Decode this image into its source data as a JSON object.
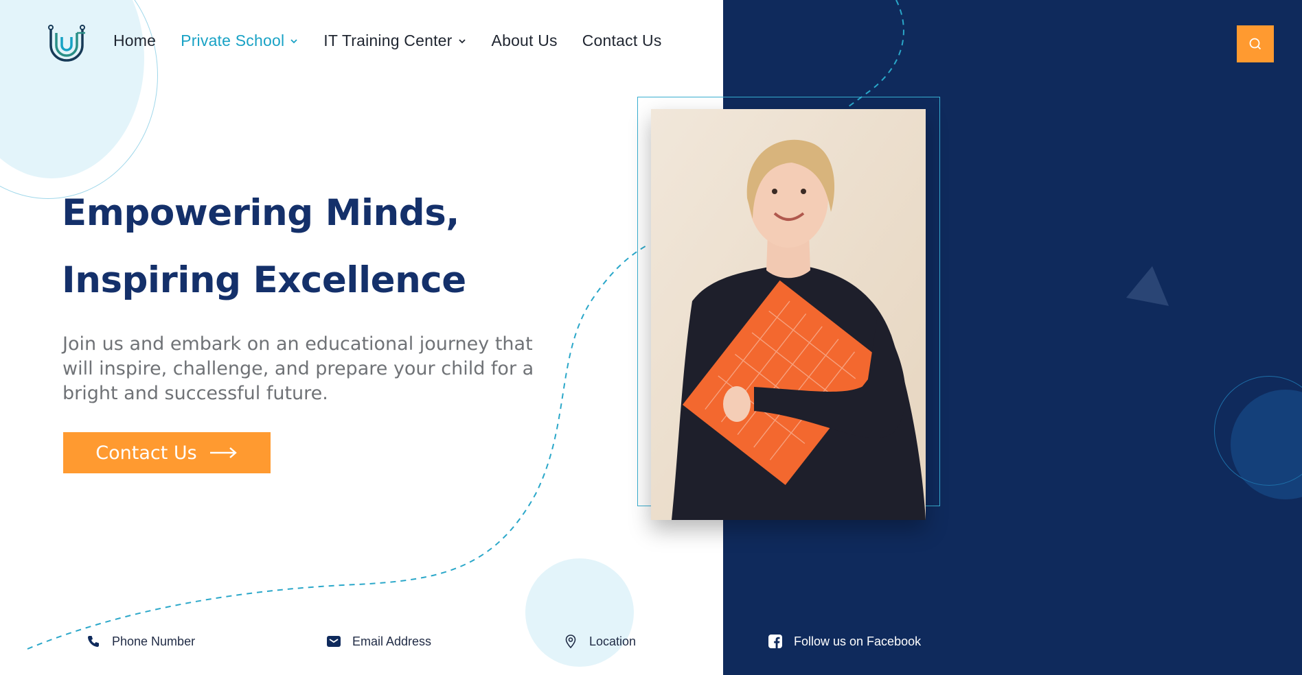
{
  "nav": {
    "items": [
      {
        "label": "Home"
      },
      {
        "label": "Private School"
      },
      {
        "label": "IT Training Center"
      },
      {
        "label": "About Us"
      },
      {
        "label": "Contact Us"
      }
    ]
  },
  "hero": {
    "title_line1": "Empowering Minds,",
    "title_line2": "Inspiring Excellence",
    "subtitle_line1": "Join us and embark on an educational journey that",
    "subtitle_line2": "will inspire, challenge, and prepare your child for a",
    "subtitle_line3": "bright and successful future.",
    "cta_label": "Contact Us"
  },
  "footer": {
    "phone_label": "Phone Number",
    "email_label": "Email Address",
    "location_label": "Location",
    "facebook_label": "Follow us on Facebook"
  },
  "icons": {
    "logo": "logo-icon",
    "search": "search-icon",
    "chevron": "chevron-down-icon",
    "arrow": "arrow-right-icon",
    "phone": "phone-icon",
    "email": "email-icon",
    "location": "location-pin-icon",
    "facebook": "facebook-icon"
  },
  "colors": {
    "navy": "#0f2a5c",
    "accent_orange": "#ff9a30",
    "accent_cyan": "#19a2c5",
    "heading": "#14306a",
    "body_text": "#6f7276"
  }
}
